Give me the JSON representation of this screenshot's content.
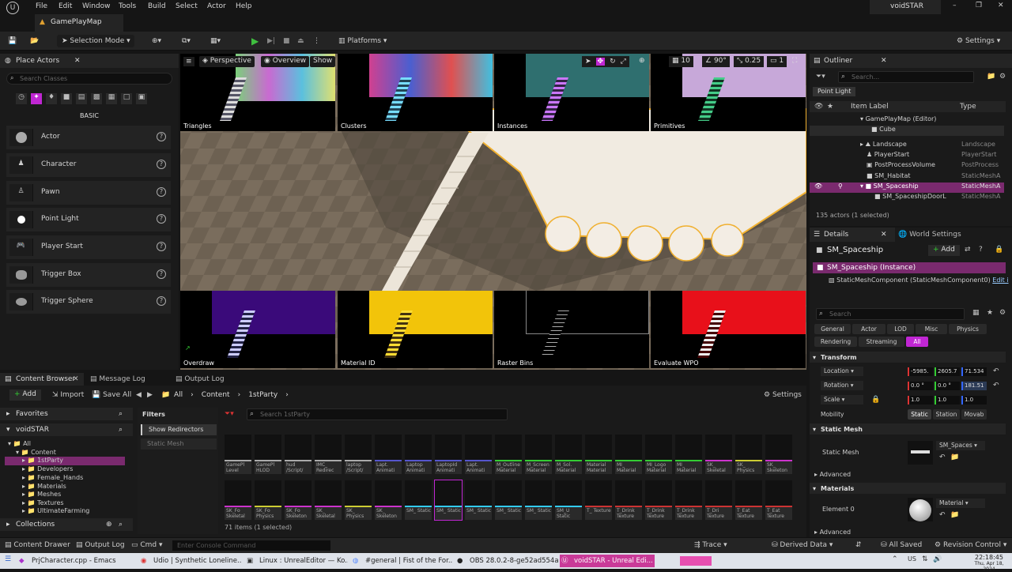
{
  "app": {
    "title": "voidSTAR",
    "document_tab": "GamePlayMap"
  },
  "menu": [
    "File",
    "Edit",
    "Window",
    "Tools",
    "Build",
    "Select",
    "Actor",
    "Help"
  ],
  "toolbar": {
    "selection_mode": "Selection Mode",
    "platforms": "Platforms",
    "settings": "Settings"
  },
  "place_actors": {
    "tab_label": "Place Actors",
    "search_placeholder": "Search Classes",
    "category": "BASIC",
    "items": [
      "Actor",
      "Character",
      "Pawn",
      "Point Light",
      "Player Start",
      "Trigger Box",
      "Trigger Sphere"
    ]
  },
  "viewport": {
    "perspective": "Perspective",
    "overview": "Overview",
    "show": "Show",
    "grid_size": "10",
    "angle": "90°",
    "scale_snap": "0.25",
    "camera_speed": "1",
    "top_tiles": [
      "Triangles",
      "Clusters",
      "Instances",
      "Primitives"
    ],
    "bottom_tiles": [
      "Overdraw",
      "Material ID",
      "Raster Bins",
      "Evaluate WPO"
    ]
  },
  "outliner": {
    "tab_label": "Outliner",
    "search_placeholder": "Search...",
    "filter_chip": "Point Light",
    "col_label": "Item Label",
    "col_type": "Type",
    "rows": [
      {
        "name": "GamePlayMap (Editor)",
        "type": ""
      },
      {
        "name": "Cube",
        "type": ""
      },
      {
        "name": "Landscape",
        "type": "Landscape"
      },
      {
        "name": "PlayerStart",
        "type": "PlayerStart"
      },
      {
        "name": "PostProcessVolume",
        "type": "PostProcess"
      },
      {
        "name": "SM_Habitat",
        "type": "StaticMeshA"
      },
      {
        "name": "SM_Spaceship",
        "type": "StaticMeshA"
      },
      {
        "name": "SM_SpaceshipDoorL",
        "type": "StaticMeshA"
      }
    ],
    "count": "135 actors (1 selected)"
  },
  "details": {
    "tab_label": "Details",
    "world_settings": "World Settings",
    "object_name": "SM_Spaceship",
    "add": "Add",
    "instance": "SM_Spaceship (Instance)",
    "component": "StaticMeshComponent (StaticMeshComponent0)",
    "edit": "Edit i",
    "search_placeholder": "Search",
    "filters": [
      "General",
      "Actor",
      "LOD",
      "Misc",
      "Physics",
      "Rendering",
      "Streaming",
      "All"
    ],
    "transform_label": "Transform",
    "location_label": "Location",
    "location": [
      "-5985.",
      "2605.7",
      "71.534"
    ],
    "rotation_label": "Rotation",
    "rotation": [
      "0.0 °",
      "0.0 °",
      "181.51"
    ],
    "scale_label": "Scale",
    "scale": [
      "1.0",
      "1.0",
      "1.0"
    ],
    "mobility_label": "Mobility",
    "mobility": [
      "Static",
      "Station",
      "Movab"
    ],
    "static_mesh_section": "Static Mesh",
    "static_mesh_label": "Static Mesh",
    "static_mesh_value": "SM_Spaces",
    "advanced": "Advanced",
    "materials_section": "Materials",
    "element0_label": "Element 0",
    "material_value": "Material",
    "advanced2": "Advanced"
  },
  "content_browser": {
    "tab_label": "Content Browser",
    "message_log": "Message Log",
    "output_log": "Output Log",
    "add": "Add",
    "import": "Import",
    "save_all": "Save All",
    "path": [
      "All",
      "Content",
      "1stParty"
    ],
    "settings": "Settings",
    "favorites": "Favorites",
    "project": "voidSTAR",
    "tree": [
      "All",
      "Content",
      "1stParty",
      "Developers",
      "Female_Hands",
      "Materials",
      "Meshes",
      "Textures",
      "UltimateFarming"
    ],
    "collections": "Collections",
    "filters_label": "Filters",
    "filter_items": [
      "Show Redirectors",
      "Static Mesh"
    ],
    "search_placeholder": "Search 1stParty",
    "count": "71 items (1 selected)",
    "row1": [
      "GamePl Level",
      "GamePl HLOD",
      "hud /Script/",
      "IMC_ Redirec",
      "laptop /Script/",
      "Lapt. Animati",
      "Laptop Animati",
      "LaptopId Animati",
      "Lapt. Animati",
      "M_Outline Material",
      "M_Screen Material",
      "M_Sol. Material",
      "Material Material",
      "MI_ Material",
      "MI_Logo Material",
      "MI_ Material",
      "SK_ Skeletal",
      "SK_ Physics",
      "SK_ Skeleton"
    ],
    "row2": [
      "SK_Fo Skeletal",
      "SK_Fo Physics",
      "SK_Fo Skeleton",
      "SK_ Skeletal",
      "SK_ Physics",
      "SK_ Skeleton",
      "SM_ Static",
      "SM_ Static",
      "SM_ Static",
      "SM_ Static",
      "SM_ Static",
      "SM_U Static",
      "T_ Texture",
      "T_Drink Texture",
      "T_Drink Texture",
      "T_Drink Texture",
      "T_Dri Texture",
      "T_Eat Texture",
      "T_Eat Texture"
    ]
  },
  "status": {
    "content_drawer": "Content Drawer",
    "output_log": "Output Log",
    "cmd": "Cmd",
    "console_placeholder": "Enter Console Command",
    "trace": "Trace",
    "derived_data": "Derived Data",
    "all_saved": "All Saved",
    "revision_control": "Revision Control"
  },
  "taskbar": {
    "tasks": [
      "PrjCharacter.cpp - Emacs",
      "Udio | Synthetic Loneline...",
      "Linux : UnrealEditor — Ko...",
      "#general | Fist of the For...",
      "OBS 28.0.2-8-ge52ad554a ...",
      "voidSTAR - Unreal Edi..."
    ],
    "lang": "US",
    "time": "22:18:45",
    "date": "Thu, Apr 18, 2024"
  },
  "colors": {
    "accent": "#c026d3",
    "selection": "#7a2a6e",
    "play": "#3fbf3f"
  }
}
